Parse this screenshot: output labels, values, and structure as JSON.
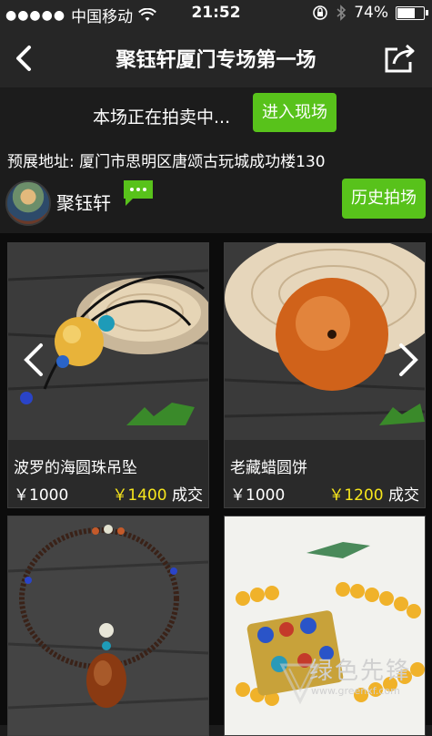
{
  "status_bar": {
    "carrier": "中国移动",
    "time": "21:52",
    "battery": "74%",
    "battery_level": 0.74
  },
  "nav": {
    "title": "聚钰轩厦门专场第一场"
  },
  "live": {
    "text": "本场正在拍卖中...",
    "enter_label": "进入现场"
  },
  "address": "预展地址: 厦门市思明区唐颂古玩城成功楼130",
  "shop": {
    "name": "聚钰轩",
    "history_label": "历史拍场"
  },
  "items": [
    {
      "name": "波罗的海圆珠吊坠",
      "price": "￥1000",
      "deal_amount": "￥1400",
      "deal_suffix": "成交"
    },
    {
      "name": "老藏蜡圆饼",
      "price": "￥1000",
      "deal_amount": "￥1200",
      "deal_suffix": "成交"
    },
    {
      "name": "",
      "price": "",
      "deal_amount": "",
      "deal_suffix": ""
    },
    {
      "name": "",
      "price": "",
      "deal_amount": "",
      "deal_suffix": ""
    }
  ],
  "watermark": {
    "brand": "绿色先锋",
    "url": "www.greenxf.com"
  },
  "colors": {
    "accent_green": "#58c21b",
    "deal_yellow": "#f7e61c",
    "background": "#1c1c1c"
  },
  "icons": {
    "back": "chevron-left-icon",
    "share": "share-icon",
    "chat": "chat-icon",
    "signal": "signal-dots-icon",
    "wifi": "wifi-icon",
    "lock": "rotation-lock-icon",
    "bluetooth": "bluetooth-icon"
  }
}
